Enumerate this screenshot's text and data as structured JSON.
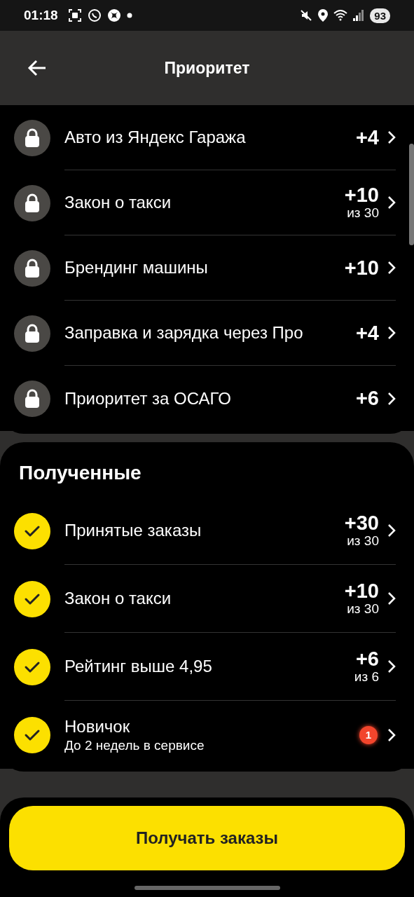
{
  "status_bar": {
    "time": "01:18",
    "battery": "93"
  },
  "header": {
    "title": "Приоритет"
  },
  "locked": [
    {
      "kind": "locked",
      "title": "Авто из Яндекс Гаража",
      "points": "+4"
    },
    {
      "kind": "locked",
      "title": "Закон о такси",
      "points": "+10",
      "limit": "из 30"
    },
    {
      "kind": "locked",
      "title": "Брендинг машины",
      "points": "+10"
    },
    {
      "kind": "locked",
      "title": "Заправка и зарядка через Про",
      "points": "+4"
    },
    {
      "kind": "locked",
      "title": "Приоритет за ОСАГО",
      "points": "+6"
    }
  ],
  "received": {
    "title": "Полученные",
    "items": [
      {
        "kind": "done",
        "title": "Принятые заказы",
        "points": "+30",
        "limit": "из 30"
      },
      {
        "kind": "done",
        "title": "Закон о такси",
        "points": "+10",
        "limit": "из 30"
      },
      {
        "kind": "done",
        "title": "Рейтинг выше 4,95",
        "points": "+6",
        "limit": "из 6"
      },
      {
        "kind": "done",
        "title": "Новичок",
        "subtitle": "До 2 недель в сервисе",
        "badge": "1"
      }
    ]
  },
  "button": "Получать заказы"
}
